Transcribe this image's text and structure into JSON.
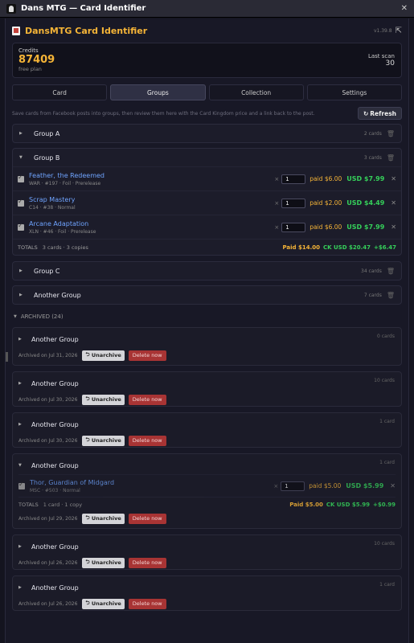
{
  "window": {
    "title": "Dans MTG — Card Identifier"
  },
  "header": {
    "title": "DansMTG Card Identifier",
    "version": "v1.39.8"
  },
  "credits": {
    "label": "Credits",
    "value": "87409",
    "plan": "free plan",
    "last_scan_label": "Last scan",
    "last_scan_value": "30"
  },
  "tabs": [
    {
      "label": "Card"
    },
    {
      "label": "Groups"
    },
    {
      "label": "Collection"
    },
    {
      "label": "Settings"
    }
  ],
  "hint": "Save cards from Facebook posts into groups, then review them here with the Card Kingdom price and a link back to the post.",
  "refresh_label": "Refresh",
  "groups": [
    {
      "name": "Group A",
      "count": "2 cards"
    },
    {
      "name": "Group B",
      "count": "3 cards",
      "cards": [
        {
          "name": "Feather, the Redeemed",
          "meta": "WAR · #197 · Foil · Prerelease",
          "qty": "1",
          "paid": "paid $6.00",
          "usd": "USD $7.99"
        },
        {
          "name": "Scrap Mastery",
          "meta": "C14 · #38 · Normal",
          "qty": "1",
          "paid": "paid $2.00",
          "usd": "USD $4.49"
        },
        {
          "name": "Arcane Adaptation",
          "meta": "XLN · #46 · Foil · Prerelease",
          "qty": "1",
          "paid": "paid $6.00",
          "usd": "USD $7.99"
        }
      ],
      "totals": {
        "label": "TOTALS",
        "count": "3 cards · 3 copies",
        "paid": "Paid $14.00",
        "ck": "CK USD $20.47",
        "diff": "+$6.47"
      }
    },
    {
      "name": "Group C",
      "count": "34 cards"
    },
    {
      "name": "Another Group",
      "count": "7 cards"
    }
  ],
  "archived": {
    "label": "ARCHIVED (24)",
    "unarchive_label": "Unarchive",
    "delete_label": "Delete now",
    "items": [
      {
        "name": "Another Group",
        "count": "0 cards",
        "date": "Archived on Jul 31, 2026"
      },
      {
        "name": "Another Group",
        "count": "10 cards",
        "date": "Archived on Jul 30, 2026"
      },
      {
        "name": "Another Group",
        "count": "1 card",
        "date": "Archived on Jul 30, 2026"
      },
      {
        "name": "Another Group",
        "count": "1 card",
        "date": "Archived on Jul 29, 2026",
        "card": {
          "name": "Thor, Guardian of Midgard",
          "meta": "MSC · #503 · Normal",
          "qty": "1",
          "paid": "paid $5.00",
          "usd": "USD $5.99"
        },
        "totals": {
          "label": "TOTALS",
          "count": "1 card · 1 copy",
          "paid": "Paid $5.00",
          "ck": "CK USD $5.99",
          "diff": "+$0.99"
        }
      },
      {
        "name": "Another Group",
        "count": "10 cards",
        "date": "Archived on Jul 26, 2026"
      },
      {
        "name": "Another Group",
        "count": "1 card",
        "date": "Archived on Jul 26, 2026"
      }
    ]
  },
  "colors": {
    "accent": "#f5b437",
    "price_green": "#35d05a",
    "link_blue": "#6fa4ff",
    "delete_red": "#a83434"
  }
}
